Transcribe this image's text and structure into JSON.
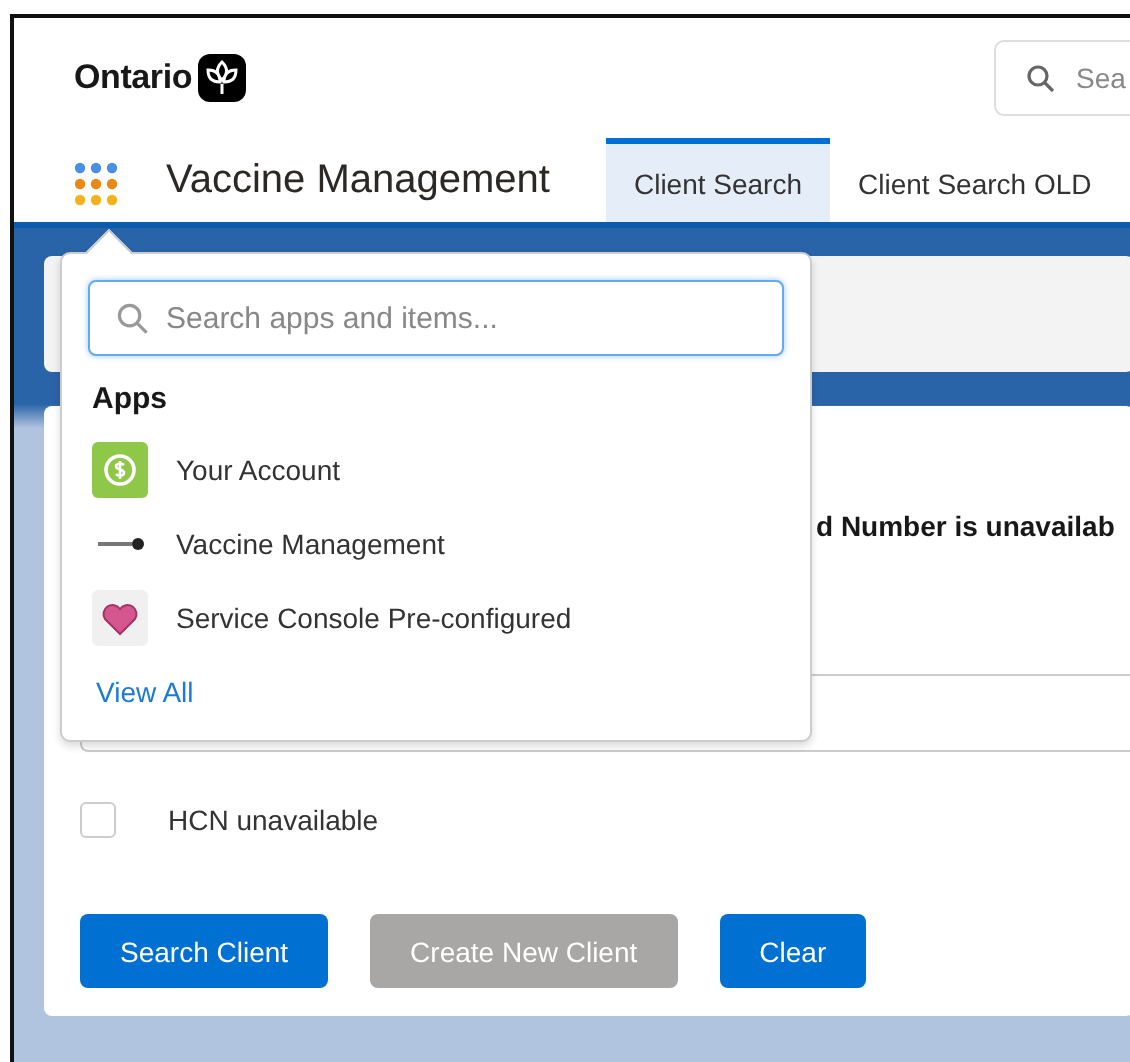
{
  "header": {
    "logo_text": "Ontario",
    "search": {
      "placeholder": "Sea"
    }
  },
  "nav": {
    "app_name": "Vaccine Management",
    "tabs": [
      {
        "label": "Client Search",
        "selected": true
      },
      {
        "label": "Client Search OLD",
        "selected": false
      }
    ]
  },
  "app_launcher": {
    "search": {
      "placeholder": "Search apps and items..."
    },
    "section": "Apps",
    "apps": [
      {
        "name": "Your Account",
        "kind": "account"
      },
      {
        "name": "Vaccine Management",
        "kind": "ontario"
      },
      {
        "name": "Service Console Pre-configured",
        "kind": "heart"
      }
    ],
    "link": "View All"
  },
  "form": {
    "notice": "d Number is unavailab",
    "hcn": {
      "label": "HCN unavailable",
      "checked": false
    },
    "buttons": [
      {
        "label": "Search Client",
        "disabled": false
      },
      {
        "label": "Create New Client",
        "disabled": true
      },
      {
        "label": "Clear",
        "disabled": false
      }
    ]
  }
}
